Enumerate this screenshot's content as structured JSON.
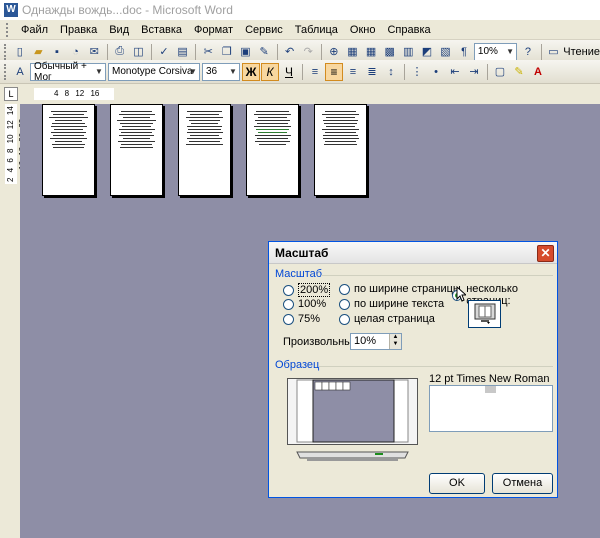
{
  "window": {
    "title": "Однажды вождь...doc - Microsoft Word",
    "app_icon": "W"
  },
  "menu": [
    "Файл",
    "Правка",
    "Вид",
    "Вставка",
    "Формат",
    "Сервис",
    "Таблица",
    "Окно",
    "Справка"
  ],
  "toolbar_standard": {
    "zoom_value": "10%",
    "reading_label": "Чтение"
  },
  "toolbar_format": {
    "style_value": "Обычный + Мог",
    "font_value": "Monotype Corsiva",
    "size_value": "36",
    "bold_label": "Ж",
    "italic_label": "К",
    "underline_label": "Ч"
  },
  "ruler": {
    "corner_glyph": "L",
    "h_ticks": "4 8 12 16",
    "v_ticks": "2 4 6 8 10 12 14 16 18 20 22"
  },
  "dialog": {
    "title": "Масштаб",
    "zoom_group": "Масштаб",
    "options": {
      "z200": "200%",
      "z100": "100%",
      "z75": "75%",
      "page_width": "по ширине страницы",
      "text_width": "по ширине текста",
      "whole_page": "целая страница",
      "many_pages": "несколько страниц:"
    },
    "selected": "many_pages",
    "custom_label": "Произвольный:",
    "custom_value": "10%",
    "preview_group": "Образец",
    "font_sample": "12 pt Times New Roman",
    "ok_label": "OK",
    "cancel_label": "Отмена"
  },
  "colors": {
    "workspace": "#8e8ea6",
    "dialog_bg": "#ece9d8",
    "group_label": "#0046d5",
    "close_button": "#d64b2c"
  }
}
